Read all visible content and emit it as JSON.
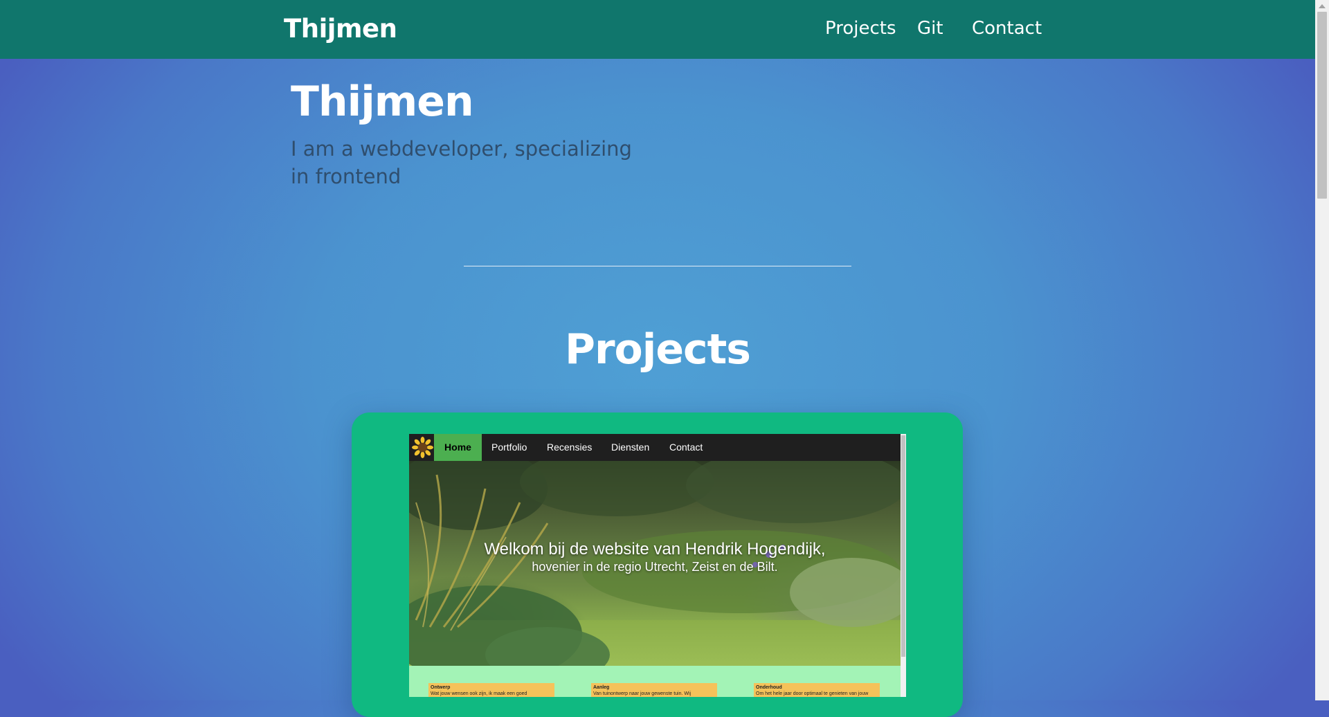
{
  "nav": {
    "brand": "Thijmen",
    "links": [
      "Projects",
      "Git",
      "Contact"
    ]
  },
  "hero": {
    "title": "Thijmen",
    "subtitle": "I am a webdeveloper, specializing in frontend"
  },
  "projects": {
    "heading": "Projects",
    "preview": {
      "nav_items": [
        "Home",
        "Portfolio",
        "Recensies",
        "Diensten",
        "Contact"
      ],
      "active_item": "Home",
      "headline": "Welkom bij de website van Hendrik Hogendijk,",
      "subheadline": "hovenier in de regio Utrecht, Zeist en de Bilt.",
      "cards": [
        {
          "title": "Ontwerp",
          "text": "Wat jouw wensen ook zijn, ik maak een goed"
        },
        {
          "title": "Aanleg",
          "text": "Van tuinontwerp naar jouw gewenste tuin. Wij"
        },
        {
          "title": "Onderhoud",
          "text": "Om het hele jaar door optimaal te genieten van jouw"
        }
      ]
    }
  },
  "colors": {
    "navbar": "#10766c",
    "card": "#10b981",
    "preview_active": "#4caf50"
  }
}
